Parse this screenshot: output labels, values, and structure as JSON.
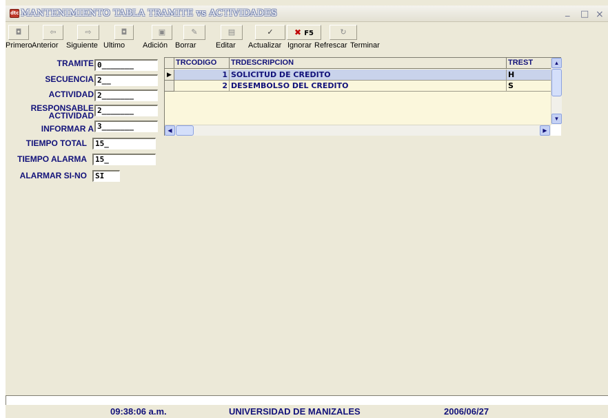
{
  "window": {
    "title": "MANTENIMIENTO TABLA TRAMITE vs ACTIVIDADES",
    "app_icon_text": "dtc",
    "controls": {
      "minimize": "_",
      "maximize": "□",
      "close": "×"
    }
  },
  "toolbar": {
    "buttons": [
      {
        "name": "first",
        "icon": "first-record-icon",
        "glyph": "◘"
      },
      {
        "name": "previous",
        "icon": "arrow-left-icon",
        "glyph": "⇦"
      },
      {
        "name": "next",
        "icon": "arrow-right-icon",
        "glyph": "⇨"
      },
      {
        "name": "last",
        "icon": "last-record-icon",
        "glyph": "◘"
      },
      {
        "name": "add",
        "icon": "floppy-disk-icon",
        "glyph": "▣"
      },
      {
        "name": "delete",
        "icon": "eraser-icon",
        "glyph": "✎"
      },
      {
        "name": "edit",
        "icon": "edit-form-icon",
        "glyph": "▤"
      },
      {
        "name": "update",
        "icon": "checkmark-icon",
        "glyph": "✓"
      },
      {
        "name": "ignore",
        "icon": "cancel-x-icon",
        "glyph": "✖",
        "text": "F5"
      },
      {
        "name": "refresh",
        "icon": "refresh-icon",
        "glyph": "↻"
      }
    ],
    "labels": {
      "first": "Primero",
      "previous": "Anterior",
      "next": "Siguiente",
      "last": "Ultimo",
      "add": "Adición",
      "delete": "Borrar",
      "edit": "Editar",
      "update": "Actualizar",
      "ignore": "Ignorar",
      "refresh": "Refrescar",
      "exit": "Terminar"
    }
  },
  "form": {
    "tramite": {
      "label": "TRAMITE",
      "value": "0_______"
    },
    "secuencia": {
      "label": "SECUENCIA",
      "value": "2__"
    },
    "actividad": {
      "label": "ACTIVIDAD",
      "value": "2_______"
    },
    "responsable": {
      "label_line1": "RESPONSABLE",
      "label_line2": "ACTIVIDAD",
      "value": "2_______"
    },
    "informar": {
      "label": "INFORMAR A",
      "value": "3_______"
    },
    "tiempo_total": {
      "label": "TIEMPO TOTAL",
      "value": "15_"
    },
    "tiempo_alarma": {
      "label": "TIEMPO ALARMA",
      "value": "15_"
    },
    "alarmar": {
      "label": "ALARMAR SI-NO",
      "value": "SI"
    }
  },
  "grid": {
    "columns": [
      "TRCODIGO",
      "TRDESCRIPCION",
      "TREST"
    ],
    "rows": [
      {
        "trcodigo": "1",
        "trdescripcion": "SOLICITUD DE CREDITO",
        "trest": "H",
        "selected": true
      },
      {
        "trcodigo": "2",
        "trdescripcion": "DESEMBOLSO DEL CREDITO",
        "trest": "S",
        "selected": false
      }
    ]
  },
  "status": {
    "time": "09:38:06 a.m.",
    "organization": "UNIVERSIDAD DE MANIZALES",
    "date": "2006/06/27"
  },
  "colors": {
    "label_blue": "#12127a",
    "grid_background": "#fbf7dc",
    "selected_row": "#c9d3eb",
    "window_face": "#ece9d8"
  }
}
